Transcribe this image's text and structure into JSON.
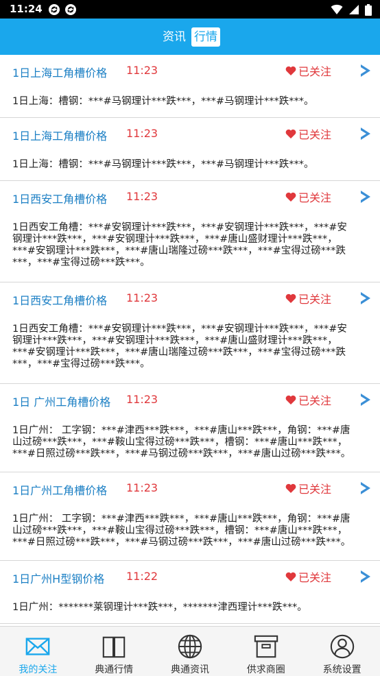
{
  "status_bar": {
    "time": "11:24"
  },
  "header": {
    "tabs": [
      {
        "label": "资讯",
        "active": false
      },
      {
        "label": "行情",
        "active": true
      }
    ]
  },
  "colors": {
    "accent": "#1aa7ec",
    "title": "#1b7fc4",
    "red": "#e0383c"
  },
  "items": [
    {
      "title": "1日上海工角槽价格",
      "time": "11:23",
      "follow": "已关注",
      "lines": [
        "1日上海：槽钢：***#马钢理计***跌***，***#马钢理计***跌***。"
      ]
    },
    {
      "title": "1日上海工角槽价格",
      "time": "11:23",
      "follow": "已关注",
      "lines": [
        "1日上海：槽钢：***#马钢理计***跌***，***#马钢理计***跌***。"
      ]
    },
    {
      "title": "1日西安工角槽价格",
      "time": "11:23",
      "follow": "已关注",
      "lines": [
        "1日西安工角槽：***#安钢理计***跌***，***#安钢理计***跌***，***#安",
        "钢理计***跌***，***#安钢理计***跌***，***#唐山盛财理计***跌***，",
        "***#安钢理计***跌***，***#唐山瑞隆过磅***跌***，***#宝得过磅***跌",
        "***，***#宝得过磅***跌***。"
      ]
    },
    {
      "title": "1日西安工角槽价格",
      "time": "11:23",
      "follow": "已关注",
      "lines": [
        "1日西安工角槽：***#安钢理计***跌***，***#安钢理计***跌***，***#安",
        "钢理计***跌***，***#安钢理计***跌***，***#唐山盛财理计***跌***，",
        "***#安钢理计***跌***，***#唐山瑞隆过磅***跌***，***#宝得过磅***跌",
        "***，***#宝得过磅***跌***。"
      ]
    },
    {
      "title": "1日 广州工角槽价格",
      "time": "11:23",
      "follow": "已关注",
      "lines": [
        "1日广州：  工字钢：***#津西***跌***，***#唐山***跌***，角钢：***#唐",
        "山过磅***跌***，***#鞍山宝得过磅***跌***，槽钢：***#唐山***跌***，",
        "***#日照过磅***跌***，***#马钢过磅***跌***，***#唐山过磅***跌***。"
      ]
    },
    {
      "title": "1日广州工角槽价格",
      "time": "11:23",
      "follow": "已关注",
      "lines": [
        "1日广州：  工字钢：***#津西***跌***，***#唐山***跌***，角钢：***#唐",
        "山过磅***跌***，***#鞍山宝得过磅***跌***，槽钢：***#唐山***跌***，",
        "***#日照过磅***跌***，***#马钢过磅***跌***，***#唐山过磅***跌***。"
      ]
    },
    {
      "title": "1日广州H型钢价格",
      "time": "11:22",
      "follow": "已关注",
      "lines": [
        "1日广州：*******莱钢理计***跌***，*******津西理计***跌***。"
      ]
    }
  ],
  "bottom_nav": [
    {
      "label": "我的关注",
      "icon": "mail-icon",
      "active": true
    },
    {
      "label": "典通行情",
      "icon": "book-icon",
      "active": false
    },
    {
      "label": "典通资讯",
      "icon": "globe-icon",
      "active": false
    },
    {
      "label": "供求商圈",
      "icon": "archive-box-icon",
      "active": false
    },
    {
      "label": "系统设置",
      "icon": "user-icon",
      "active": false
    }
  ]
}
